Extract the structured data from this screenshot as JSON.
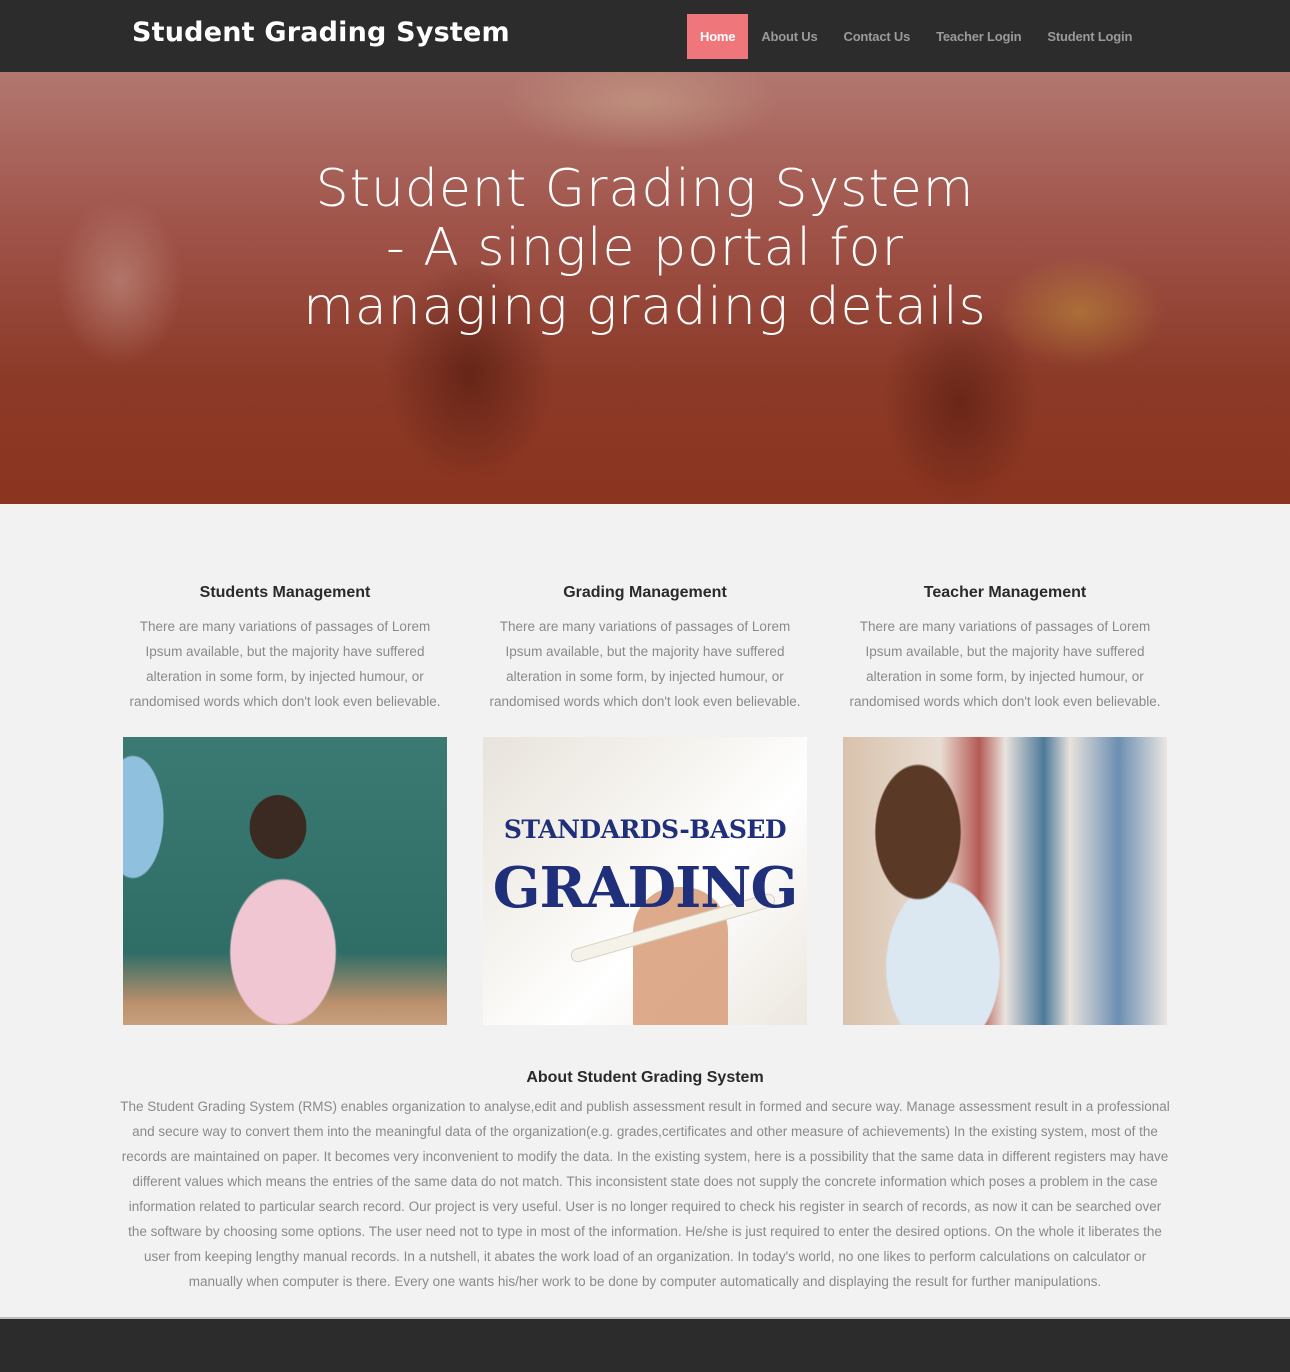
{
  "navbar": {
    "brand": "Student Grading System",
    "items": [
      {
        "label": "Home",
        "active": true
      },
      {
        "label": "About Us",
        "active": false
      },
      {
        "label": "Contact Us",
        "active": false
      },
      {
        "label": "Teacher Login",
        "active": false
      },
      {
        "label": "Student Login",
        "active": false
      }
    ]
  },
  "colors": {
    "navbar_bg": "#2c2c2c",
    "active_nav_bg": "#ef767a",
    "page_bg": "#f2f2f2",
    "hero_overlay": "#8b3420",
    "grading_text": "#1f2f7a"
  },
  "hero": {
    "title": "Student Grading System - A single portal for managing grading details"
  },
  "features": [
    {
      "title": "Students Management",
      "text": "There are many variations of passages of Lorem Ipsum available, but the majority have suffered alteration in some form, by injected humour, or randomised words which don't look even believable.",
      "image": "teacher-writing-at-chalkboard-photo"
    },
    {
      "title": "Grading Management",
      "text": "There are many variations of passages of Lorem Ipsum available, but the majority have suffered alteration in some form, by injected humour, or randomised words which don't look even believable.",
      "image": "standards-based-grading-photo",
      "image_text_line1": "STANDARDS-BASED",
      "image_text_line2": "GRADING"
    },
    {
      "title": "Teacher Management",
      "text": "There are many variations of passages of Lorem Ipsum available, but the majority have suffered alteration in some form, by injected humour, or randomised words which don't look even believable.",
      "image": "teacher-in-library-photo"
    }
  ],
  "about": {
    "title": "About Student Grading System",
    "text": "The Student Grading System (RMS) enables organization to analyse,edit and publish assessment result in formed and secure way. Manage assessment result in a professional and secure way to convert them into the meaningful data of the organization(e.g. grades,certificates and other measure of achievements) In the existing system, most of the records are maintained on paper. It becomes very inconvenient to modify the data. In the existing system, here is a possibility that the same data in different registers may have different values which means the entries of the same data do not match. This inconsistent state does not supply the concrete information which poses a problem in the case information related to particular search record. Our project is very useful. User is no longer required to check his register in search of records, as now it can be searched over the software by choosing some options. The user need not to type in most of the information. He/she is just required to enter the desired options. On the whole it liberates the user from keeping lengthy manual records. In a nutshell, it abates the work load of an organization. In today's world, no one likes to perform calculations on calculator or manually when computer is there. Every one wants his/her work to be done by computer automatically and displaying the result for further manipulations."
  }
}
